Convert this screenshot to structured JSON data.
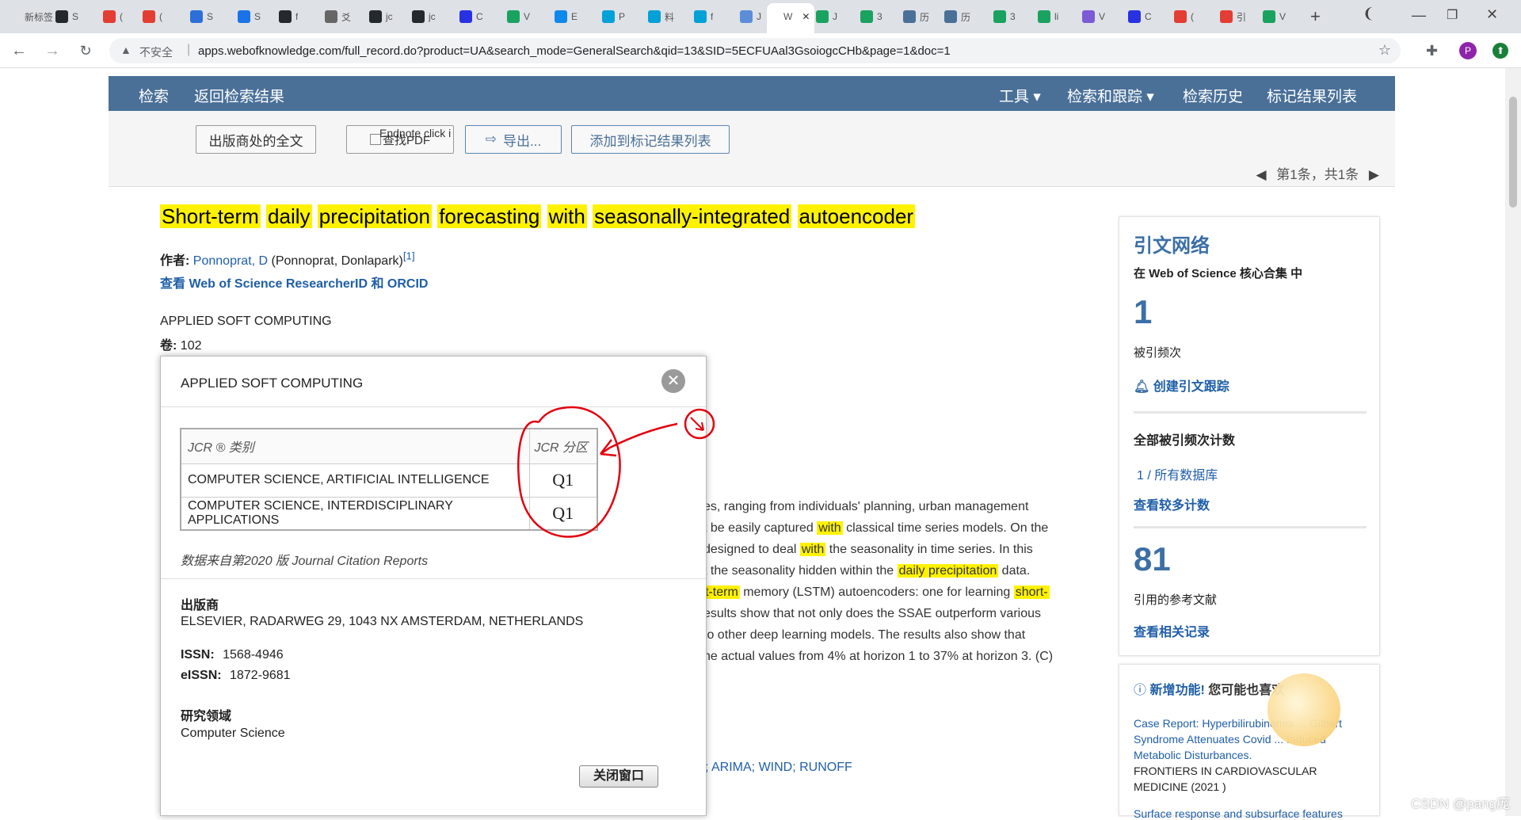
{
  "browser": {
    "tabs": [
      {
        "label": "新标签",
        "icon": "generic-tab-icon",
        "color": "#dee1e6"
      },
      {
        "label": "S",
        "icon": "github-icon",
        "color": "#24292e"
      },
      {
        "label": "(",
        "icon": "csdn-icon",
        "color": "#e33e33"
      },
      {
        "label": "(",
        "icon": "baidu-icon",
        "color": "#e33e33"
      },
      {
        "label": "S",
        "icon": "site-icon",
        "color": "#2d6fd8"
      },
      {
        "label": "S",
        "icon": "k-icon",
        "color": "#1a73e8"
      },
      {
        "label": "f",
        "icon": "github-icon",
        "color": "#24292e"
      },
      {
        "label": "爻",
        "icon": "globe-icon",
        "color": "#666"
      },
      {
        "label": "jc",
        "icon": "github-icon",
        "color": "#24292e"
      },
      {
        "label": "jc",
        "icon": "github-icon",
        "color": "#24292e"
      },
      {
        "label": "C",
        "icon": "baidu-paw-icon",
        "color": "#2932e1"
      },
      {
        "label": "V",
        "icon": "app-icon",
        "color": "#1aa260"
      },
      {
        "label": "E",
        "icon": "zhihu-icon",
        "color": "#0f88eb"
      },
      {
        "label": "P",
        "icon": "bilibili-icon",
        "color": "#00a1d6"
      },
      {
        "label": "料",
        "icon": "bilibili-icon",
        "color": "#00a1d6"
      },
      {
        "label": "f",
        "icon": "bilibili-icon",
        "color": "#00a1d6"
      },
      {
        "label": "J",
        "icon": "cloud-icon",
        "color": "#5b8dd9"
      },
      {
        "label": "W",
        "icon": "wos-icon",
        "color": "#ffffff"
      },
      {
        "label": "J",
        "icon": "app-icon",
        "color": "#1aa260"
      },
      {
        "label": "3",
        "icon": "app-icon",
        "color": "#1aa260"
      },
      {
        "label": "历",
        "icon": "globe-icon",
        "color": "#4a7098"
      },
      {
        "label": "历",
        "icon": "globe-icon",
        "color": "#4a7098"
      },
      {
        "label": "3",
        "icon": "app-icon",
        "color": "#1aa260"
      },
      {
        "label": "li",
        "icon": "app-icon",
        "color": "#1aa260"
      },
      {
        "label": "V",
        "icon": "planet-icon",
        "color": "#7b5bd6"
      },
      {
        "label": "C",
        "icon": "baidu-paw-icon",
        "color": "#2932e1"
      },
      {
        "label": "(",
        "icon": "csdn-icon",
        "color": "#e33e33"
      },
      {
        "label": "引",
        "icon": "csdn-icon",
        "color": "#e33e33"
      },
      {
        "label": "V",
        "icon": "app-icon",
        "color": "#1aa260"
      }
    ],
    "insecure_label": "不安全",
    "url": "apps.webofknowledge.com/full_record.do?product=UA&search_mode=GeneralSearch&qid=13&SID=5ECFUAal3GsoiogcCHb&page=1&doc=1",
    "avatar_letter": "P"
  },
  "header": {
    "left": [
      "检索",
      "返回检索结果"
    ],
    "right": [
      "工具 ▾",
      "检索和跟踪 ▾",
      "检索历史",
      "标记结果列表"
    ]
  },
  "toolbar": {
    "fulltext": "出版商处的全文",
    "findpdf": "查找PDF",
    "endnote_alt": "Endnote click i",
    "export": "导出...",
    "add_marked": "添加到标记结果列表",
    "pager": "第1条，共1条"
  },
  "record": {
    "title_words": [
      "Short-term",
      "daily",
      "precipitation",
      "forecasting",
      "with",
      "seasonally-integrated",
      "autoencoder"
    ],
    "author_label": "作者:",
    "author_link": "Ponnoprat, D",
    "author_full": "(Ponnoprat, Donlapark)",
    "author_ref": "[1]",
    "researcher_link": "查看 Web of Science ResearcherID 和 ORCID",
    "journal": "APPLIED SOFT COMPUTING",
    "volume_label": "卷:",
    "volume": "102",
    "abstract_lines": [
      [
        "es, ranging from individuals' planning, urban management"
      ],
      [
        "t be easily captured ",
        "with",
        " classical time series models. On the"
      ],
      [
        "designed to deal ",
        "with",
        " the seasonality in time series. In this"
      ],
      [
        "t the seasonality hidden within the ",
        "daily precipitation",
        " data."
      ],
      [
        "",
        "t-term",
        " memory (LSTM) autoencoders: one for learning ",
        "short-"
      ],
      [
        "esults show that not only does the SSAE outperform various"
      ],
      [
        "to other deep learning models. The results also show that"
      ],
      [
        "he actual values from 4% at horizon 1 to 37% at horizon 3. (C)"
      ]
    ],
    "keywords": "; ARIMA; WIND; RUNOFF"
  },
  "sidebar": {
    "title": "引文网络",
    "scope": "在 Web of Science 核心合集 中",
    "times_cited": "1",
    "times_cited_label": "被引频次",
    "create_alert": "创建引文跟踪",
    "all_counts": "全部被引频次计数",
    "all_db": "1 / 所有数据库",
    "more_counts": "查看较多计数",
    "refs": "81",
    "refs_label": "引用的参考文献",
    "related": "查看相关记录"
  },
  "sidebar2": {
    "heading_new": "新增功能!",
    "heading_rest": "您可能也喜欢",
    "item1_title": "Case Report: Hyperbilirubinemia ... Gilbert Syndrome Attenuates Covid ... Induced Metabolic Disturbances.",
    "item1_journal": "FRONTIERS IN CARDIOVASCULAR MEDICINE (2021 )",
    "item2_title": "Surface response and subsurface features"
  },
  "modal": {
    "title": "APPLIED SOFT COMPUTING",
    "col_category": "JCR ® 类别",
    "col_quartile": "JCR 分区",
    "rows": [
      {
        "category": "COMPUTER SCIENCE, ARTIFICIAL INTELLIGENCE",
        "quartile": "Q1"
      },
      {
        "category": "COMPUTER SCIENCE, INTERDISCIPLINARY APPLICATIONS",
        "quartile": "Q1"
      }
    ],
    "note": "数据来自第2020 版 Journal Citation Reports",
    "publisher_label": "出版商",
    "publisher": "ELSEVIER, RADARWEG 29, 1043 NX AMSTERDAM, NETHERLANDS",
    "issn_label": "ISSN:",
    "issn": "1568-4946",
    "eissn_label": "eISSN:",
    "eissn": "1872-9681",
    "field_label": "研究领域",
    "field": "Computer Science",
    "close_window": "关闭窗口"
  },
  "watermark": "CSDN @pang庞",
  "colors": {
    "header": "#4a7098",
    "highlight": "#fff200",
    "link": "#1f5ea8",
    "annotation": "#e3000f"
  }
}
